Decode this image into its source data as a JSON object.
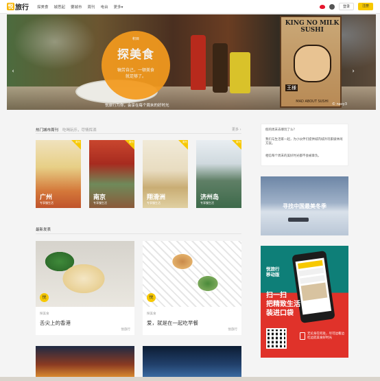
{
  "nav": {
    "logo_mark": "悦",
    "logo_text": "旅行",
    "items": [
      "探美食",
      "城思起",
      "要城市",
      "周刊",
      "电台",
      "更多▾"
    ],
    "login": "登录",
    "register": "注册"
  },
  "banner": {
    "tag": "积目",
    "title": "探美食",
    "subtitle_line1": "犒劳自己，一顿美食",
    "subtitle_line2": "就足够了。",
    "caption": "悦旅行为你，会享在每个周末的好时光",
    "credit": "© navy3",
    "poster_title": "KING NO MILK SUSHI",
    "poster_mark": "王様",
    "poster_foot": "MAD ABOUT SUSHI"
  },
  "hot_cities": {
    "title": "热门城市周刊",
    "subtitle": "吃喝玩乐，尽情挥洒",
    "more": "更多 ›",
    "items": [
      {
        "name": "广州",
        "sub": "专享慢生活",
        "flag": "周刊"
      },
      {
        "name": "南京",
        "sub": "专享慢生活",
        "flag": "周刊"
      },
      {
        "name": "翔滑洲",
        "sub": "专享慢生活",
        "flag": "周刊"
      },
      {
        "name": "济州岛",
        "sub": "专享慢生活",
        "flag": "周刊"
      }
    ]
  },
  "recommend": {
    "title": "最新发表",
    "cards": [
      {
        "badge": "悦",
        "category": "探美食",
        "title": "舌尖上的香港",
        "source": "悦旅行"
      },
      {
        "badge": "悦",
        "category": "探美食",
        "title": "爱，就是在一起吃早餐",
        "source": "悦旅行"
      }
    ]
  },
  "sidebar": {
    "box_line1": "假的周末去哪玩了么？",
    "box_line2": "我们与生活家一起，为小伙伴们提供城内城外玩家级休闲方案。",
    "box_line3": "相信每个周末的美好时光都不会被辜负。",
    "ad1_text": "寻找中国最美冬季",
    "ad2_brand_line1": "悦旅行",
    "ad2_brand_line2": "移动版",
    "ad2_head_line1": "扫一扫",
    "ad2_head_line2": "把精致生活",
    "ad2_head_line3": "装进口袋",
    "ad2_note": "无论身在何处，尽可边看边吃边逛美食好时光"
  },
  "colors": {
    "accent": "#f7c800",
    "banner_circle": "#f39a1e",
    "ad_teal": "#0e7f78",
    "ad_red": "#e0322a"
  }
}
